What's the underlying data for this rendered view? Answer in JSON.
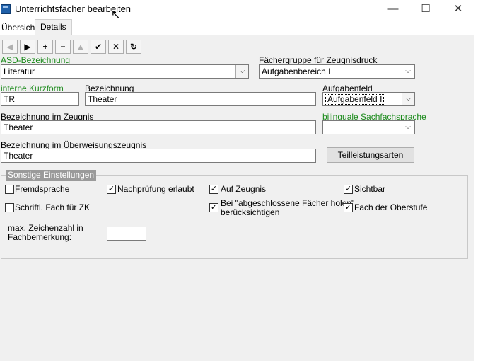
{
  "window": {
    "title": "Unterrichtsfächer bearbeiten",
    "minimize": "—",
    "maximize": "☐",
    "close": "✕"
  },
  "tabs": [
    {
      "label": "Übersicht"
    },
    {
      "label": "Details"
    }
  ],
  "toolbar": {
    "first": "◀",
    "next": "▶",
    "add": "+",
    "remove": "−",
    "up": "▲",
    "confirm": "✔",
    "cancel": "✕",
    "refresh": "↻"
  },
  "form": {
    "asd_label": "ASD-Bezeichnung",
    "asd_value": "Literatur",
    "faechergruppe_label": "Fächergruppe für Zeugnisdruck",
    "faechergruppe_value": "Aufgabenbereich I",
    "kurzform_label": "interne Kurzform",
    "kurzform_value": "TR",
    "bezeichnung_label": "Bezeichnung",
    "bezeichnung_value": "Theater",
    "aufgabenfeld_label": "Aufgabenfeld",
    "aufgabenfeld_value": "Aufgabenfeld I",
    "zeugnis_label": "Bezeichnung im Zeugnis",
    "zeugnis_value": "Theater",
    "bilingual_label": "bilinguale Sachfachsprache",
    "bilingual_value": "",
    "ueberweisung_label": "Bezeichnung im Überweisungszeugnis",
    "ueberweisung_value": "Theater",
    "teilleistung_button": "Teilleistungsarten"
  },
  "settings": {
    "title": "Sonstige Einstellungen",
    "fremdsprache": {
      "label": "Fremdsprache",
      "checked": false
    },
    "nachpruefung": {
      "label": "Nachprüfung erlaubt",
      "checked": true
    },
    "auf_zeugnis": {
      "label": "Auf Zeugnis",
      "checked": true
    },
    "sichtbar": {
      "label": "Sichtbar",
      "checked": true
    },
    "schriftl_zk": {
      "label": "Schriftl. Fach für ZK",
      "checked": false
    },
    "abgeschlossen": {
      "label_line1": "Bei \"abgeschlossene Fächer holen\"",
      "label_line2": "berücksichtigen",
      "checked": true
    },
    "oberstufe": {
      "label": "Fach der Oberstufe",
      "checked": true
    },
    "max_zeichen_line1": "max. Zeichenzahl in",
    "max_zeichen_line2": "Fachbemerkung:",
    "max_zeichen_value": ""
  },
  "icons": {
    "check": "✓",
    "combo_arrow": "⌵",
    "cursor": "↖"
  }
}
